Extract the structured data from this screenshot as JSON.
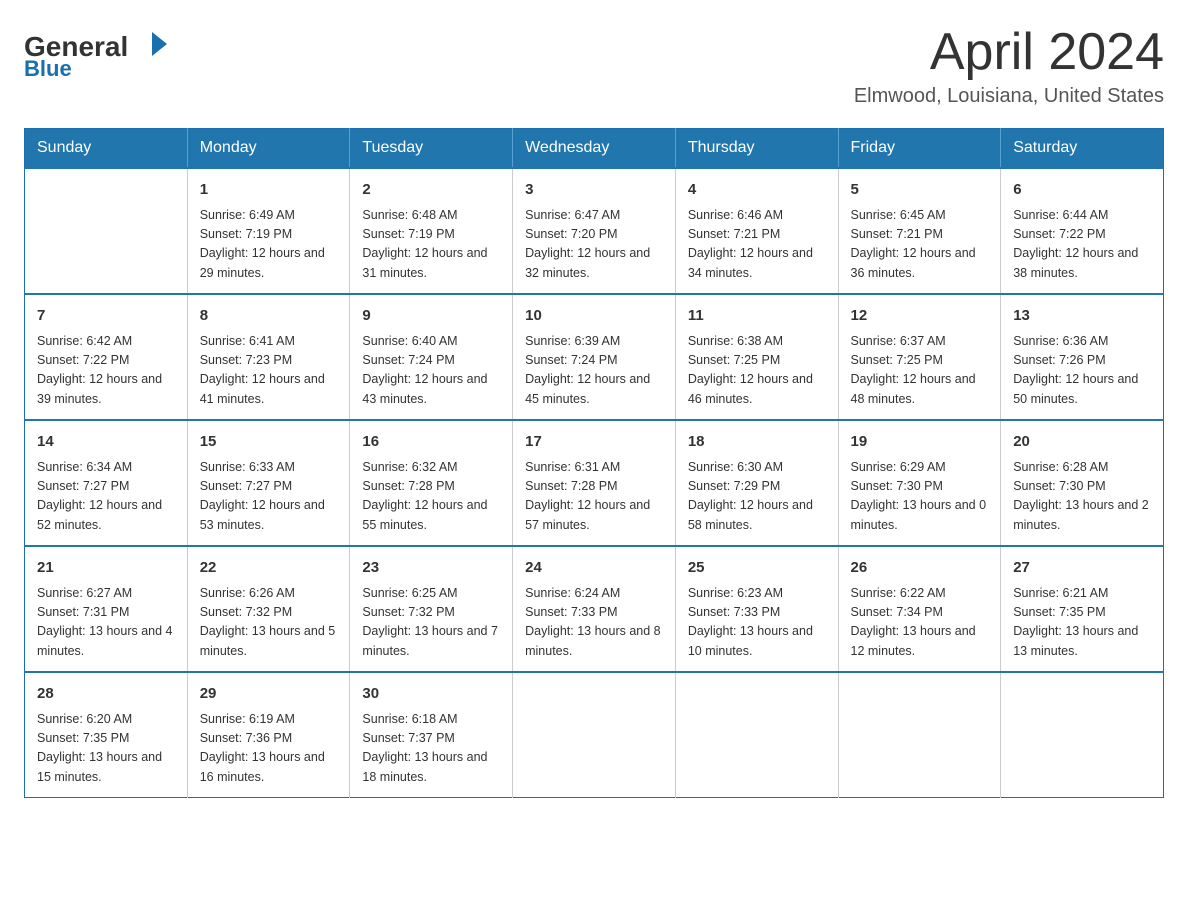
{
  "header": {
    "logo_general": "General",
    "logo_blue": "Blue",
    "title": "April 2024",
    "location": "Elmwood, Louisiana, United States"
  },
  "calendar": {
    "days_of_week": [
      "Sunday",
      "Monday",
      "Tuesday",
      "Wednesday",
      "Thursday",
      "Friday",
      "Saturday"
    ],
    "weeks": [
      [
        {
          "day": "",
          "info": ""
        },
        {
          "day": "1",
          "info": "Sunrise: 6:49 AM\nSunset: 7:19 PM\nDaylight: 12 hours\nand 29 minutes."
        },
        {
          "day": "2",
          "info": "Sunrise: 6:48 AM\nSunset: 7:19 PM\nDaylight: 12 hours\nand 31 minutes."
        },
        {
          "day": "3",
          "info": "Sunrise: 6:47 AM\nSunset: 7:20 PM\nDaylight: 12 hours\nand 32 minutes."
        },
        {
          "day": "4",
          "info": "Sunrise: 6:46 AM\nSunset: 7:21 PM\nDaylight: 12 hours\nand 34 minutes."
        },
        {
          "day": "5",
          "info": "Sunrise: 6:45 AM\nSunset: 7:21 PM\nDaylight: 12 hours\nand 36 minutes."
        },
        {
          "day": "6",
          "info": "Sunrise: 6:44 AM\nSunset: 7:22 PM\nDaylight: 12 hours\nand 38 minutes."
        }
      ],
      [
        {
          "day": "7",
          "info": "Sunrise: 6:42 AM\nSunset: 7:22 PM\nDaylight: 12 hours\nand 39 minutes."
        },
        {
          "day": "8",
          "info": "Sunrise: 6:41 AM\nSunset: 7:23 PM\nDaylight: 12 hours\nand 41 minutes."
        },
        {
          "day": "9",
          "info": "Sunrise: 6:40 AM\nSunset: 7:24 PM\nDaylight: 12 hours\nand 43 minutes."
        },
        {
          "day": "10",
          "info": "Sunrise: 6:39 AM\nSunset: 7:24 PM\nDaylight: 12 hours\nand 45 minutes."
        },
        {
          "day": "11",
          "info": "Sunrise: 6:38 AM\nSunset: 7:25 PM\nDaylight: 12 hours\nand 46 minutes."
        },
        {
          "day": "12",
          "info": "Sunrise: 6:37 AM\nSunset: 7:25 PM\nDaylight: 12 hours\nand 48 minutes."
        },
        {
          "day": "13",
          "info": "Sunrise: 6:36 AM\nSunset: 7:26 PM\nDaylight: 12 hours\nand 50 minutes."
        }
      ],
      [
        {
          "day": "14",
          "info": "Sunrise: 6:34 AM\nSunset: 7:27 PM\nDaylight: 12 hours\nand 52 minutes."
        },
        {
          "day": "15",
          "info": "Sunrise: 6:33 AM\nSunset: 7:27 PM\nDaylight: 12 hours\nand 53 minutes."
        },
        {
          "day": "16",
          "info": "Sunrise: 6:32 AM\nSunset: 7:28 PM\nDaylight: 12 hours\nand 55 minutes."
        },
        {
          "day": "17",
          "info": "Sunrise: 6:31 AM\nSunset: 7:28 PM\nDaylight: 12 hours\nand 57 minutes."
        },
        {
          "day": "18",
          "info": "Sunrise: 6:30 AM\nSunset: 7:29 PM\nDaylight: 12 hours\nand 58 minutes."
        },
        {
          "day": "19",
          "info": "Sunrise: 6:29 AM\nSunset: 7:30 PM\nDaylight: 13 hours\nand 0 minutes."
        },
        {
          "day": "20",
          "info": "Sunrise: 6:28 AM\nSunset: 7:30 PM\nDaylight: 13 hours\nand 2 minutes."
        }
      ],
      [
        {
          "day": "21",
          "info": "Sunrise: 6:27 AM\nSunset: 7:31 PM\nDaylight: 13 hours\nand 4 minutes."
        },
        {
          "day": "22",
          "info": "Sunrise: 6:26 AM\nSunset: 7:32 PM\nDaylight: 13 hours\nand 5 minutes."
        },
        {
          "day": "23",
          "info": "Sunrise: 6:25 AM\nSunset: 7:32 PM\nDaylight: 13 hours\nand 7 minutes."
        },
        {
          "day": "24",
          "info": "Sunrise: 6:24 AM\nSunset: 7:33 PM\nDaylight: 13 hours\nand 8 minutes."
        },
        {
          "day": "25",
          "info": "Sunrise: 6:23 AM\nSunset: 7:33 PM\nDaylight: 13 hours\nand 10 minutes."
        },
        {
          "day": "26",
          "info": "Sunrise: 6:22 AM\nSunset: 7:34 PM\nDaylight: 13 hours\nand 12 minutes."
        },
        {
          "day": "27",
          "info": "Sunrise: 6:21 AM\nSunset: 7:35 PM\nDaylight: 13 hours\nand 13 minutes."
        }
      ],
      [
        {
          "day": "28",
          "info": "Sunrise: 6:20 AM\nSunset: 7:35 PM\nDaylight: 13 hours\nand 15 minutes."
        },
        {
          "day": "29",
          "info": "Sunrise: 6:19 AM\nSunset: 7:36 PM\nDaylight: 13 hours\nand 16 minutes."
        },
        {
          "day": "30",
          "info": "Sunrise: 6:18 AM\nSunset: 7:37 PM\nDaylight: 13 hours\nand 18 minutes."
        },
        {
          "day": "",
          "info": ""
        },
        {
          "day": "",
          "info": ""
        },
        {
          "day": "",
          "info": ""
        },
        {
          "day": "",
          "info": ""
        }
      ]
    ]
  },
  "colors": {
    "header_bg": "#2176ae",
    "header_text": "#ffffff",
    "border": "#2176ae",
    "accent_blue": "#1a6faf"
  }
}
